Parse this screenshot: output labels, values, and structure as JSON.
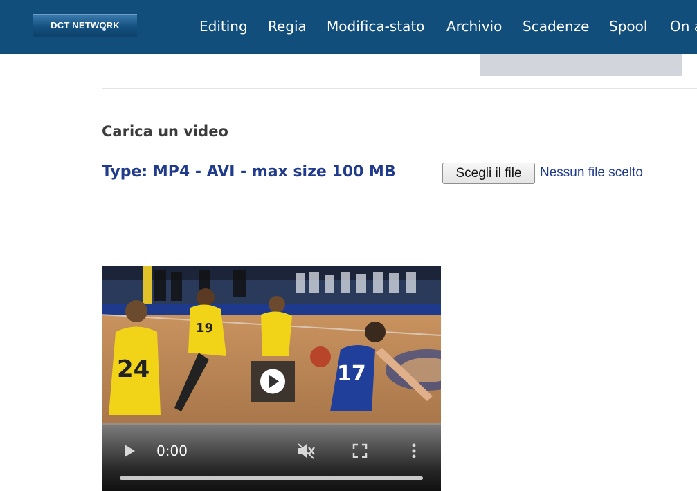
{
  "header": {
    "logo_text": "DCT NETWORK",
    "nav": [
      {
        "label": "Editing"
      },
      {
        "label": "Regia"
      },
      {
        "label": "Modifica-stato"
      },
      {
        "label": "Archivio"
      },
      {
        "label": "Scadenze"
      },
      {
        "label": "Spool"
      },
      {
        "label": "On a"
      }
    ],
    "background_color": "#124e7c"
  },
  "upload": {
    "title": "Carica un video",
    "type_info": "Type: MP4 - AVI - max size 100 MB",
    "choose_button": "Scegli il file",
    "no_file_text": "Nessun file scelto",
    "accent_color": "#203a8c"
  },
  "video": {
    "current_time": "0:00",
    "progress": 0,
    "icons": [
      "play-icon",
      "mute-icon",
      "fullscreen-icon",
      "more-options-icon",
      "center-play-icon"
    ]
  }
}
